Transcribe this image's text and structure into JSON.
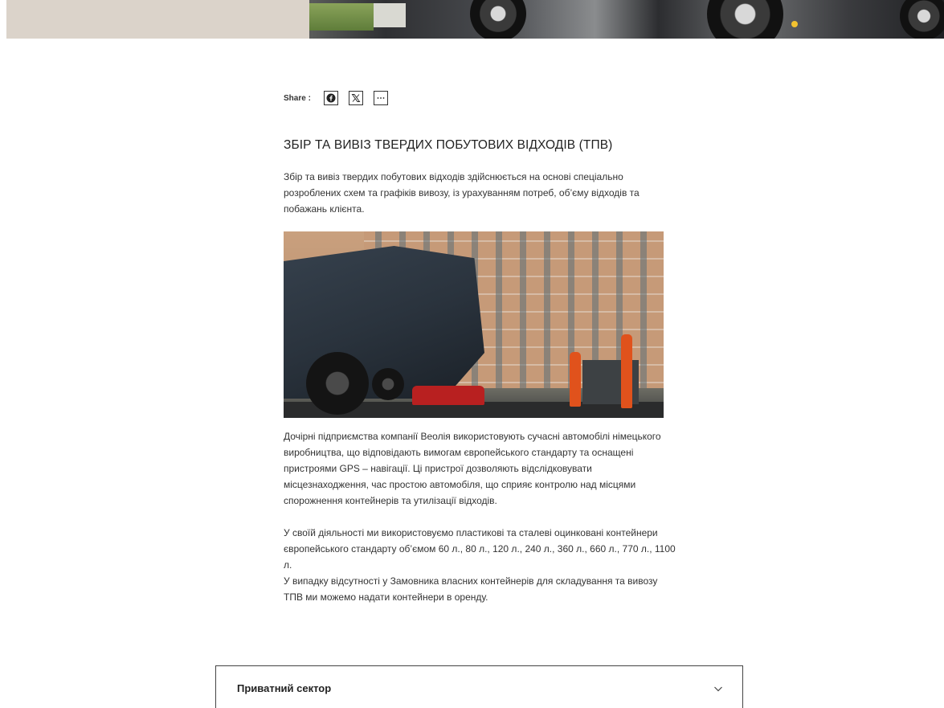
{
  "share": {
    "label": "Share :",
    "buttons": [
      {
        "icon": "facebook-icon"
      },
      {
        "icon": "x-icon"
      },
      {
        "icon": "more-icon"
      }
    ]
  },
  "article": {
    "title": "ЗБІР ТА ВИВІЗ ТВЕРДИХ ПОБУТОВИХ ВІДХОДІВ (ТПВ)",
    "intro": "Збір та вивіз твердих побутових відходів здійснюється на основі спеціально розроблених схем та графіків вивозу, із урахуванням потреб, об’єму відходів та побажань клієнта.",
    "paragraph1": "Дочірні підприємства компанії Веолія використовують сучасні автомобілі німецького виробництва, що відповідають вимогам європейського стандарту та оснащені пристроями GPS – навігації.  Ці пристрої дозволяють відслідковувати місцезнаходження, час простою автомобіля, що сприяє контролю над місцями спорожнення контейнерів та утилізації відходів.",
    "paragraph2a": "У своїй діяльності ми використовуємо пластикові та сталеві оцинковані контейнери європейського стандарту об’ємом 60 л., 80 л., 120 л., 240 л., 360 л., 660 л., 770 л., 1100 л.",
    "paragraph2b": "У випадку відсутності у Замовника власних контейнерів для складування та вивозу ТПВ ми можемо надати контейнери в оренду."
  },
  "accordion": {
    "title": "Приватний сектор"
  }
}
